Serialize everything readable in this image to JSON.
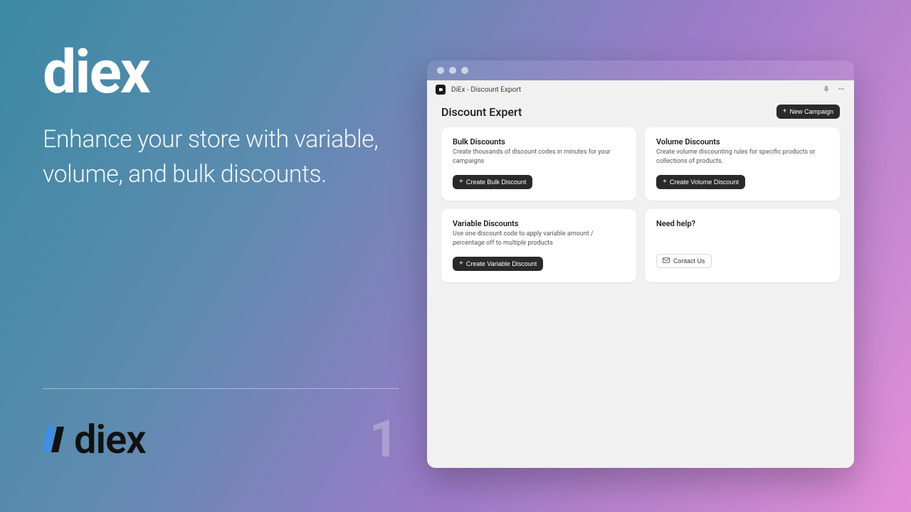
{
  "brand": {
    "title": "diex",
    "subtitle": "Enhance your store with variable, volume, and bulk discounts.",
    "logo_word": "diex",
    "page_number": "1"
  },
  "app": {
    "header_title": "DiEx - Discount Export",
    "page_heading": "Discount Expert",
    "new_campaign_label": "New Campaign",
    "cards": {
      "bulk": {
        "title": "Bulk Discounts",
        "desc": "Create thousands of discount codes in minutes for your campaigns",
        "button": "Create Bulk Discount"
      },
      "volume": {
        "title": "Volume Discounts",
        "desc": "Create volume discounting rules for specific products or collections of products.",
        "button": "Create Volume Discount"
      },
      "variable": {
        "title": "Variable Discounts",
        "desc": "Use one discount code to apply variable amount / percentage off to multiple products",
        "button": "Create Variable Discount"
      },
      "help": {
        "title": "Need help?",
        "desc": " ",
        "button": "Contact Us"
      }
    }
  }
}
